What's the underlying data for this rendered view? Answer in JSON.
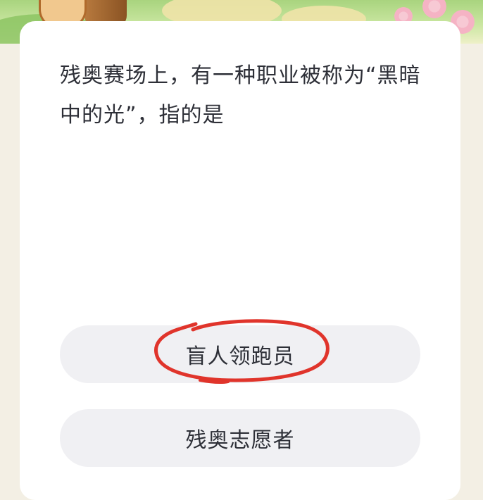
{
  "quiz": {
    "question": "残奥赛场上，有一种职业被称为“黑暗中的光”，指的是",
    "options": [
      {
        "label": "盲人领跑员",
        "annotated": true
      },
      {
        "label": "残奥志愿者",
        "annotated": false
      }
    ]
  },
  "annotation": {
    "shape": "hand-drawn ellipse",
    "color": "#e0342b",
    "target": "options.0"
  }
}
